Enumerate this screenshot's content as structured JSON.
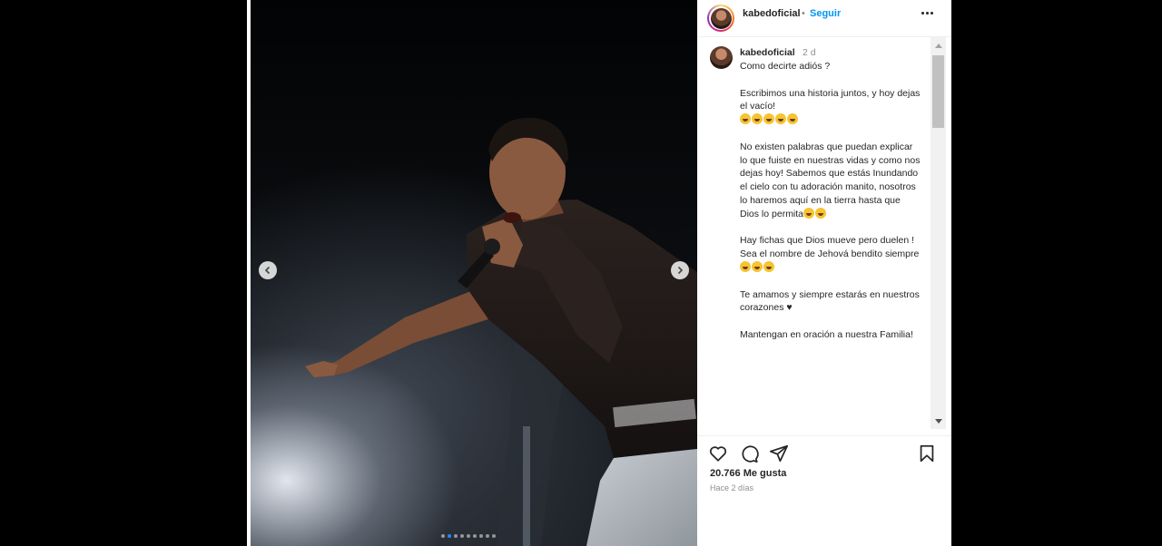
{
  "post": {
    "username": "kabedoficial",
    "separator": "•",
    "follow_label": "Seguir",
    "caption_time": "2 d",
    "caption_paragraphs": [
      "Como decirte adiós ?",
      "Escribimos una historia juntos, y hoy dejas el vacío!",
      "No existen palabras que puedan explicar lo que fuiste en nuestras vidas y como nos dejas hoy! Sabemos que estás Inundando el cielo con tu adoración manito, nosotros lo haremos aquí en la tierra hasta que Dios lo permita",
      "Hay fichas que Dios mueve pero duelen !\nSea el nombre de Jehová bendito siempre",
      "Te amamos y siempre estarás en nuestros corazones ♥",
      "Mantengan en oración a nuestra Familia!"
    ],
    "likes": "20.766 Me gusta",
    "posted_ago": "Hace 2 días"
  },
  "carousel": {
    "dot_count": 9,
    "active_index": 1
  },
  "icons": {
    "prev": "chevron-left-icon",
    "next": "chevron-right-icon",
    "like": "heart-icon",
    "comment": "comment-icon",
    "share": "paper-plane-icon",
    "save": "bookmark-icon",
    "more": "more-options-icon",
    "emoji": "loudly-crying-face-emoji"
  },
  "colors": {
    "follow": "#0095f6",
    "secondary_text": "#8e8e8e",
    "primary_text": "#262626"
  }
}
